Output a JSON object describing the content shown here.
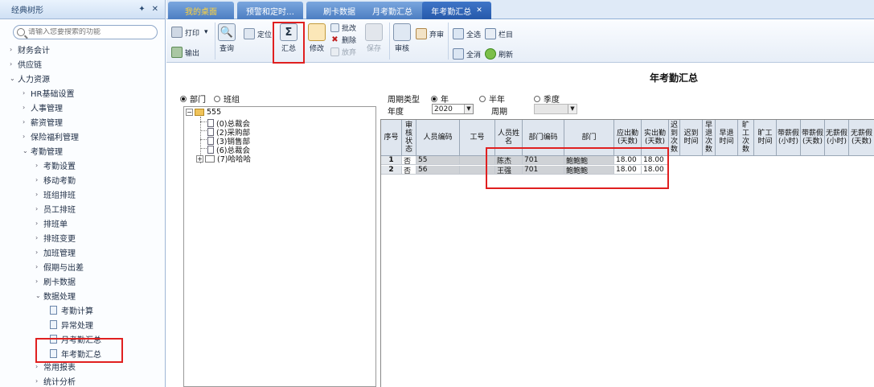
{
  "sidebar": {
    "title": "经典树形",
    "pin_icon": "pin-icon",
    "close_icon": "close-icon",
    "search_placeholder": "请输入您要搜索的功能",
    "items": [
      {
        "label": "财务会计",
        "arrow": "›"
      },
      {
        "label": "供应链",
        "arrow": "›"
      },
      {
        "label": "人力资源",
        "arrow": "⌄"
      },
      {
        "label": "HR基础设置",
        "arrow": "›"
      },
      {
        "label": "人事管理",
        "arrow": "›"
      },
      {
        "label": "薪资管理",
        "arrow": "›"
      },
      {
        "label": "保险福利管理",
        "arrow": "›"
      },
      {
        "label": "考勤管理",
        "arrow": "⌄"
      },
      {
        "label": "考勤设置",
        "arrow": "›"
      },
      {
        "label": "移动考勤",
        "arrow": "›"
      },
      {
        "label": "班组排班",
        "arrow": "›"
      },
      {
        "label": "员工排班",
        "arrow": "›"
      },
      {
        "label": "排班单",
        "arrow": "›"
      },
      {
        "label": "排班变更",
        "arrow": "›"
      },
      {
        "label": "加班管理",
        "arrow": "›"
      },
      {
        "label": "假期与出差",
        "arrow": "›"
      },
      {
        "label": "刷卡数据",
        "arrow": "›"
      },
      {
        "label": "数据处理",
        "arrow": "⌄"
      },
      {
        "label": "考勤计算",
        "arrow": ""
      },
      {
        "label": "异常处理",
        "arrow": ""
      },
      {
        "label": "月考勤汇总",
        "arrow": ""
      },
      {
        "label": "年考勤汇总",
        "arrow": ""
      },
      {
        "label": "常用报表",
        "arrow": "›"
      },
      {
        "label": "统计分析",
        "arrow": "›"
      }
    ]
  },
  "tabs": [
    {
      "label": "我的桌面"
    },
    {
      "label": "预警和定时…"
    },
    {
      "label": "刷卡数据"
    },
    {
      "label": "月考勤汇总"
    },
    {
      "label": "年考勤汇总",
      "close": "✕"
    }
  ],
  "toolbar": {
    "print": "打印",
    "print_caret": "▾",
    "export": "输出",
    "query": "查询",
    "locate": "定位",
    "summary": "汇总",
    "summary_glyph": "Σ",
    "modify": "修改",
    "batch_modify": "批改",
    "delete": "删除",
    "abandon": "放弃",
    "save": "保存",
    "audit": "审核",
    "discard_audit": "弃审",
    "select_all": "全选",
    "clear_all": "全消",
    "columns": "栏目",
    "refresh": "刷新"
  },
  "report": {
    "title": "年考勤汇总",
    "mode_dept": "部门",
    "mode_team": "班组",
    "period_type_label": "周期类型",
    "period_year": "年",
    "period_half": "半年",
    "period_quarter": "季度",
    "year_label": "年度",
    "year_value": "2020",
    "period_label": "周期",
    "period_value": ""
  },
  "dept_tree": {
    "root": "555",
    "children": [
      "(0)总裁会",
      "(2)采购部",
      "(3)销售部",
      "(6)总裁会",
      "(7)哈哈哈"
    ],
    "expand_glyph": "−",
    "collapsed_glyph": "+"
  },
  "grid": {
    "columns": [
      "序号",
      "审核状态",
      "人员编码",
      "工号",
      "人员姓名",
      "部门编码",
      "部门",
      "应出勤(天数)",
      "实出勤(天数)",
      "迟到次数",
      "迟到时间",
      "早退次数",
      "早退时间",
      "旷工次数",
      "旷工时间",
      "带薪假(小时)",
      "带薪假(天数)",
      "无薪假(小时)",
      "无薪假(天数)"
    ],
    "rows": [
      {
        "seq": "1",
        "status": "否",
        "code": "55",
        "job_no": "",
        "name": "陈杰",
        "dept_code": "701",
        "dept": "鲍鲍鲍",
        "due": "18.00",
        "actual": "18.00"
      },
      {
        "seq": "2",
        "status": "否",
        "code": "56",
        "job_no": "",
        "name": "王强",
        "dept_code": "701",
        "dept": "鲍鲍鲍",
        "due": "18.00",
        "actual": "18.00"
      }
    ]
  },
  "colors": {
    "accent": "#2659aa",
    "highlight": "#e02020",
    "tab_home_text": "#ffd23c"
  }
}
